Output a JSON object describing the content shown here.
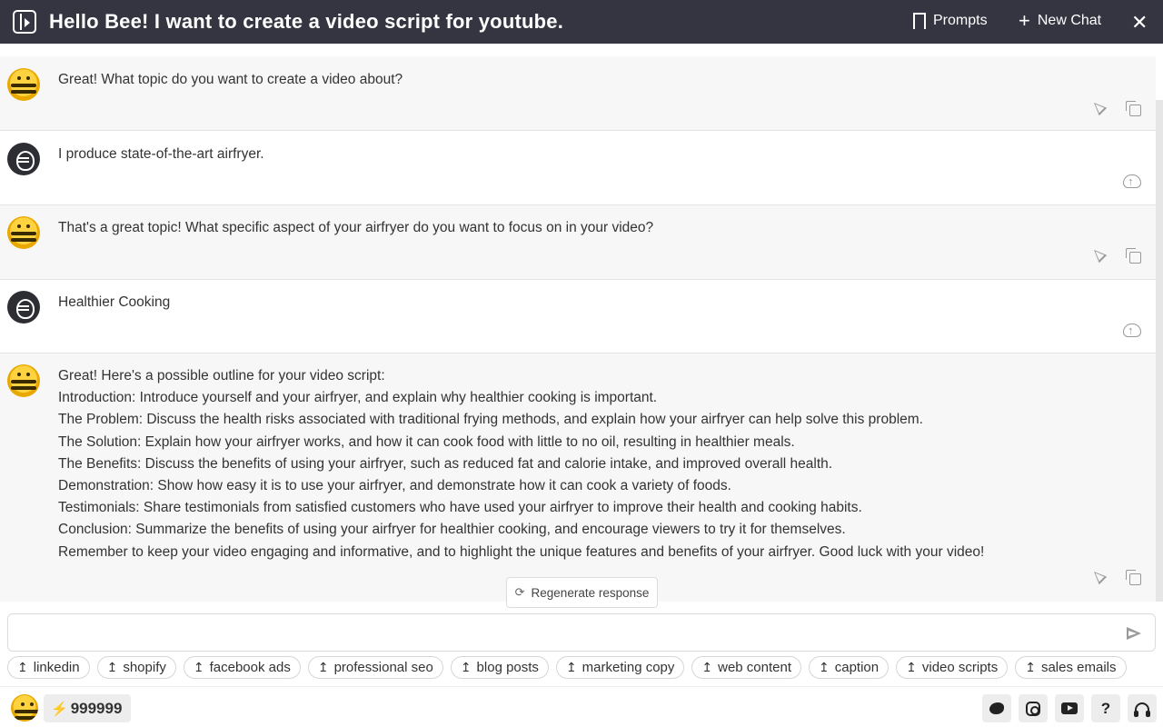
{
  "header": {
    "title": "Hello Bee! I want to create a video script for youtube.",
    "prompts_label": "Prompts",
    "new_chat_label": "New Chat",
    "close_label": "✕"
  },
  "messages": [
    {
      "role": "bot",
      "text": "Great! What topic do you want to create a video about?"
    },
    {
      "role": "user",
      "text": "I produce state-of-the-art airfryer."
    },
    {
      "role": "bot",
      "text": "That's a great topic! What specific aspect of your airfryer do you want to focus on in your video?"
    },
    {
      "role": "user",
      "text": "Healthier Cooking"
    },
    {
      "role": "bot",
      "lines": [
        "Great! Here's a possible outline for your video script:",
        "Introduction: Introduce yourself and your airfryer, and explain why healthier cooking is important.",
        "The Problem: Discuss the health risks associated with traditional frying methods, and explain how your airfryer can help solve this problem.",
        "The Solution: Explain how your airfryer works, and how it can cook food with little to no oil, resulting in healthier meals.",
        "The Benefits: Discuss the benefits of using your airfryer, such as reduced fat and calorie intake, and improved overall health.",
        "Demonstration: Show how easy it is to use your airfryer, and demonstrate how it can cook a variety of foods.",
        "Testimonials: Share testimonials from satisfied customers who have used your airfryer to improve their health and cooking habits.",
        "Conclusion: Summarize the benefits of using your airfryer for healthier cooking, and encourage viewers to try it for themselves.",
        "Remember to keep your video engaging and informative, and to highlight the unique features and benefits of your airfryer. Good luck with your video!"
      ]
    }
  ],
  "regenerate_label": "Regenerate response",
  "input": {
    "value": "",
    "placeholder": ""
  },
  "chips": [
    "linkedin",
    "shopify",
    "facebook ads",
    "professional seo",
    "blog posts",
    "marketing copy",
    "web content",
    "caption",
    "video scripts",
    "sales emails"
  ],
  "footer": {
    "credits": "999999"
  },
  "colors": {
    "header_bg": "#343541",
    "bot_bg": "#f7f7f7",
    "user_bg": "#ffffff",
    "accent_bee": "#ffd340"
  },
  "icons": [
    "sidebar-toggle-icon",
    "bookmark-icon",
    "plus-icon",
    "close-icon",
    "bee-icon",
    "bee-outline-icon",
    "cursor-icon",
    "copy-icon",
    "upload-icon",
    "refresh-icon",
    "send-icon",
    "arrow-icon",
    "bolt-icon",
    "twitter-icon",
    "instagram-icon",
    "youtube-icon",
    "help-icon",
    "headset-icon"
  ]
}
